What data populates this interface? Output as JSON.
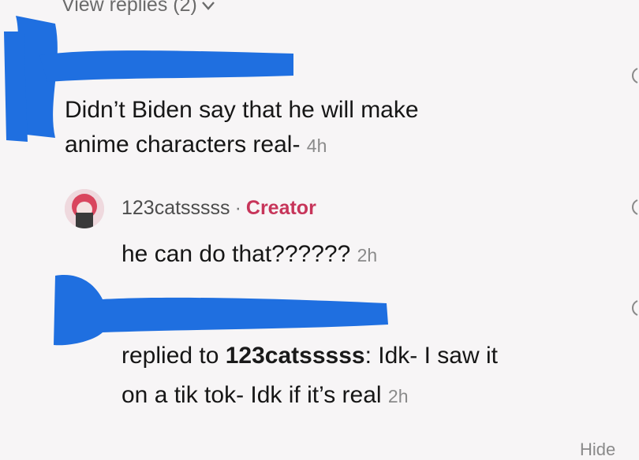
{
  "thread": {
    "view_replies_label": "View replies (2)",
    "comment": {
      "text_line1": "Didn’t Biden say that he will make",
      "text_line2": "anime characters real-",
      "timestamp": "4h"
    },
    "reply_creator": {
      "username": "123catsssss",
      "separator": "·",
      "badge": "Creator",
      "text": "he can do that??????",
      "timestamp": "2h"
    },
    "reply_user": {
      "prefix": "replied to ",
      "replied_to": "123catsssss",
      "text_after": ": Idk- I saw it",
      "text_line2": "on a tik tok- Idk if it’s real",
      "timestamp": "2h"
    },
    "hide_label": "Hide"
  },
  "colors": {
    "censor_blue": "#1f6fe0",
    "creator_badge": "#c7355a",
    "timestamp_gray": "#8a8a8a"
  }
}
